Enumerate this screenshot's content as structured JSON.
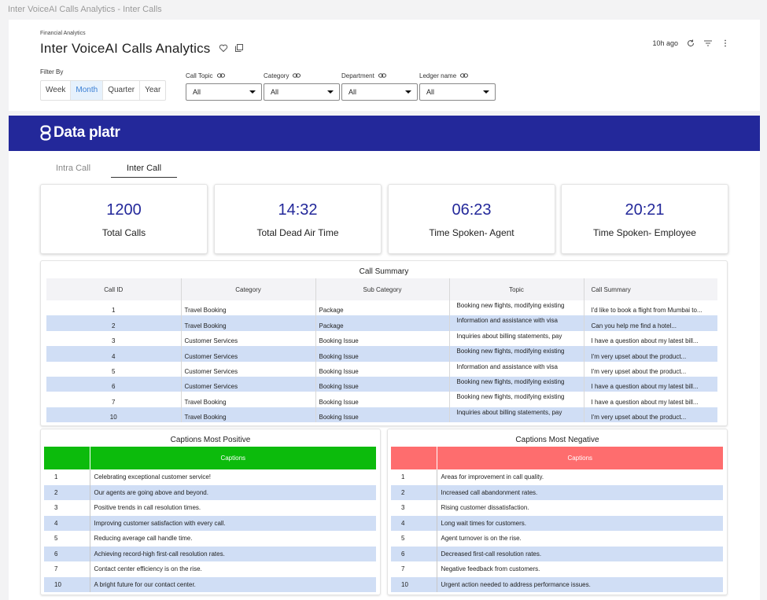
{
  "window_title": "Inter VoiceAI Calls Analytics - Inter Calls",
  "header": {
    "breadcrumb": "Financial Analytics",
    "title": "Inter VoiceAI Calls Analytics",
    "last_refreshed": "10h ago"
  },
  "filters": {
    "filter_by_label": "Filter By",
    "periods": [
      "Week",
      "Month",
      "Quarter",
      "Year"
    ],
    "active_period": "Month",
    "dropdowns": [
      {
        "label": "Call Topic",
        "value": "All"
      },
      {
        "label": "Category",
        "value": "All"
      },
      {
        "label": "Department",
        "value": "All"
      },
      {
        "label": "Ledger name",
        "value": "All"
      }
    ]
  },
  "banner": {
    "brand": "Data platr",
    "color": "#23289a"
  },
  "tabs": [
    "Intra Call",
    "Inter Call"
  ],
  "active_tab": "Inter Call",
  "kpis": [
    {
      "value": "1200",
      "label": "Total Calls"
    },
    {
      "value": "14:32",
      "label": "Total Dead Air Time"
    },
    {
      "value": "06:23",
      "label": "Time Spoken- Agent"
    },
    {
      "value": "20:21",
      "label": "Time Spoken- Employee"
    }
  ],
  "call_summary": {
    "title": "Call Summary",
    "columns": [
      "Call ID",
      "Category",
      "Sub Category",
      "Topic",
      "Call Summary"
    ],
    "rows": [
      [
        "1",
        "Travel Booking",
        "Package",
        "Booking new flights, modifying existing",
        "I'd like to book a flight from Mumbai to..."
      ],
      [
        "2",
        "Travel Booking",
        "Package",
        "Information and assistance with visa",
        "Can you help me find a hotel..."
      ],
      [
        "3",
        "Customer Services",
        "Booking Issue",
        "Inquiries about billing statements, pay",
        "I have a question about my latest bill..."
      ],
      [
        "4",
        "Customer Services",
        "Booking Issue",
        "Booking new flights, modifying existing",
        "I'm very upset about the product..."
      ],
      [
        "5",
        "Customer Services",
        "Booking Issue",
        "Information and assistance with visa",
        "I'm very upset about the product..."
      ],
      [
        "6",
        "Customer Services",
        "Booking Issue",
        "Booking new flights, modifying existing",
        "I have a question about my latest bill..."
      ],
      [
        "7",
        "Travel Booking",
        "Booking Issue",
        "Booking new flights, modifying existing",
        "I have a question about my latest bill..."
      ],
      [
        "10",
        "Travel Booking",
        "Booking Issue",
        "Inquiries about billing statements, pay",
        "I'm very upset about the product..."
      ]
    ]
  },
  "positive": {
    "title": "Captions Most Positive",
    "header": "Captions",
    "color": "#0cbb0c",
    "rows": [
      [
        "1",
        "Celebrating exceptional customer service!"
      ],
      [
        "2",
        "Our agents are going above and beyond."
      ],
      [
        "3",
        "Positive trends in call resolution times."
      ],
      [
        "4",
        "Improving customer satisfaction with every call."
      ],
      [
        "5",
        "Reducing average call handle time."
      ],
      [
        "6",
        "Achieving record-high first-call resolution rates."
      ],
      [
        "7",
        "Contact center efficiency is on the rise."
      ],
      [
        "10",
        "A bright future for our contact center."
      ]
    ]
  },
  "negative": {
    "title": "Captions Most Negative",
    "header": "Captions",
    "color": "#fe6d6e",
    "rows": [
      [
        "1",
        "Areas for improvement in call quality."
      ],
      [
        "2",
        "Increased call abandonment rates."
      ],
      [
        "3",
        "Rising customer dissatisfaction."
      ],
      [
        "4",
        "Long wait times for customers."
      ],
      [
        "5",
        "Agent turnover is on the rise."
      ],
      [
        "6",
        "Decreased first-call resolution rates."
      ],
      [
        "7",
        "Negative feedback from customers."
      ],
      [
        "10",
        "Urgent action needed to address performance issues."
      ]
    ]
  }
}
